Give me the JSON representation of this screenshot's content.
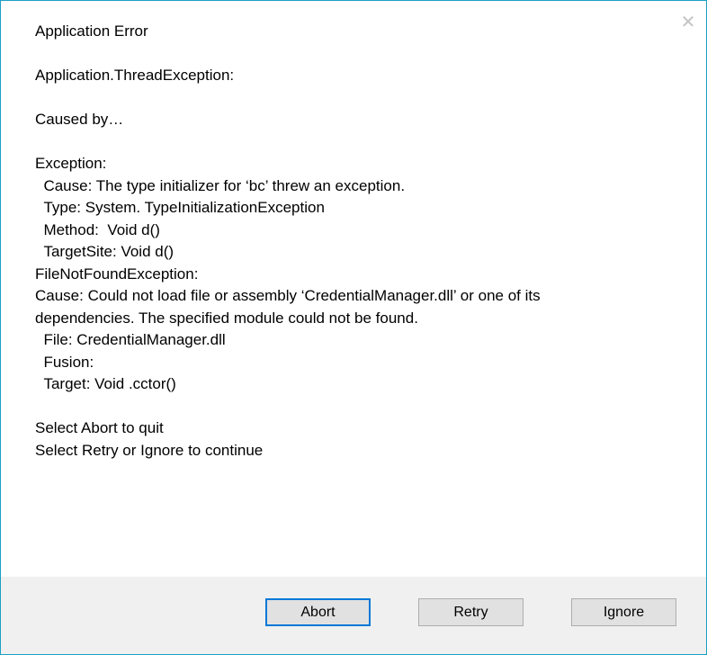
{
  "dialog": {
    "close_glyph": "✕",
    "lines": {
      "l1": "Application Error",
      "l2": "Application.ThreadException:",
      "l3": "Caused by…",
      "l4": "Exception:",
      "l5": "  Cause: The type initializer for ‘bc’ threw an exception.",
      "l6": "  Type: System. TypeInitializationException",
      "l7": "  Method:  Void d()",
      "l8": "  TargetSite: Void d()",
      "l9": "FileNotFoundException:",
      "l10": "Cause: Could not load file or assembly ‘CredentialManager.dll’ or one of its",
      "l11": "dependencies. The specified module could not be found.",
      "l12": "  File: CredentialManager.dll",
      "l13": "  Fusion:",
      "l14": "  Target: Void .cctor()",
      "l15": "Select Abort to quit",
      "l16": "Select Retry or Ignore to continue"
    }
  },
  "buttons": {
    "abort": "Abort",
    "retry": "Retry",
    "ignore": "Ignore"
  },
  "colors": {
    "border_accent": "#1ea0c4",
    "default_button_border": "#0078d7",
    "footer_bg": "#f0f0f0",
    "button_bg": "#e1e1e1"
  },
  "icons": {
    "close": "close-icon"
  }
}
